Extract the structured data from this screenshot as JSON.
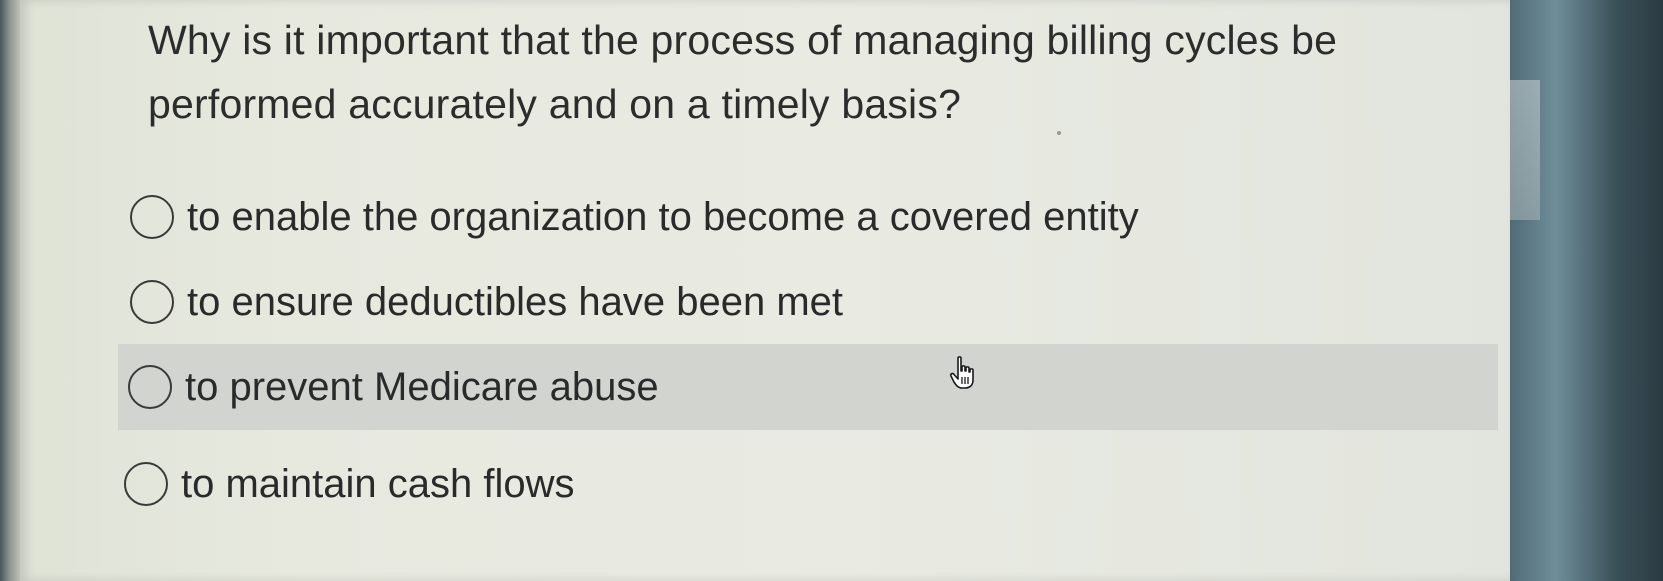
{
  "question": {
    "text": "Why is it important that the process of managing billing cycles be performed accurately and on a timely basis?"
  },
  "options": [
    {
      "label": "to enable the organization to become a covered entity",
      "selected": false
    },
    {
      "label": "to ensure deductibles have been met",
      "selected": false
    },
    {
      "label": "to prevent Medicare abuse",
      "selected": false,
      "hovered": true
    },
    {
      "label": "to maintain cash flows",
      "selected": false
    }
  ],
  "cursor": {
    "icon": "hand-pointer-icon"
  },
  "colors": {
    "text": "#2a2a2a",
    "hover_row": "#d2d4cf",
    "screen_background": "#e8eae2"
  }
}
